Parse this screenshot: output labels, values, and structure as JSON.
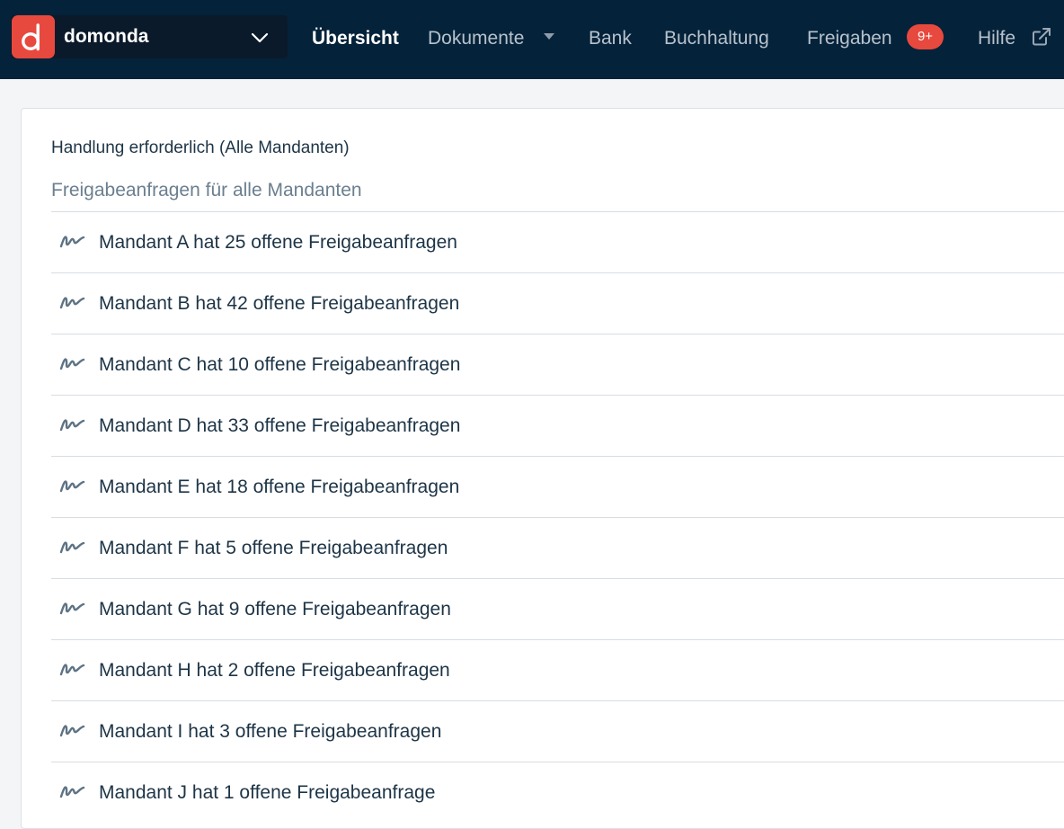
{
  "header": {
    "brand": {
      "name": "domonda",
      "logo_letter": "d",
      "logo_color": "#e8493e"
    },
    "nav": [
      {
        "label": "Übersicht",
        "active": true
      },
      {
        "label": "Dokumente",
        "has_dropdown": true
      },
      {
        "label": "Bank"
      },
      {
        "label": "Buchhaltung"
      },
      {
        "label": "Freigaben",
        "badge": "9+"
      },
      {
        "label": "Hilfe",
        "icon": "external-link-icon"
      }
    ],
    "background_color": "#04223a"
  },
  "main": {
    "title": "Handlung erforderlich (Alle Mandanten)",
    "subtitle": "Freigabeanfragen für alle Mandanten",
    "item_icon": "signature-icon",
    "items": [
      {
        "label": "Mandant A hat 25 offene Freigabeanfragen"
      },
      {
        "label": "Mandant B hat 42 offene Freigabeanfragen"
      },
      {
        "label": "Mandant C hat 10 offene Freigabeanfragen"
      },
      {
        "label": "Mandant D hat 33 offene Freigabeanfragen"
      },
      {
        "label": "Mandant E hat 18 offene Freigabeanfragen"
      },
      {
        "label": "Mandant F hat 5 offene Freigabeanfragen"
      },
      {
        "label": "Mandant G hat 9 offene Freigabeanfragen"
      },
      {
        "label": "Mandant H hat 2 offene Freigabeanfragen"
      },
      {
        "label": "Mandant I hat 3 offene Freigabeanfragen"
      },
      {
        "label": "Mandant J hat 1 offene Freigabeanfrage"
      }
    ]
  }
}
